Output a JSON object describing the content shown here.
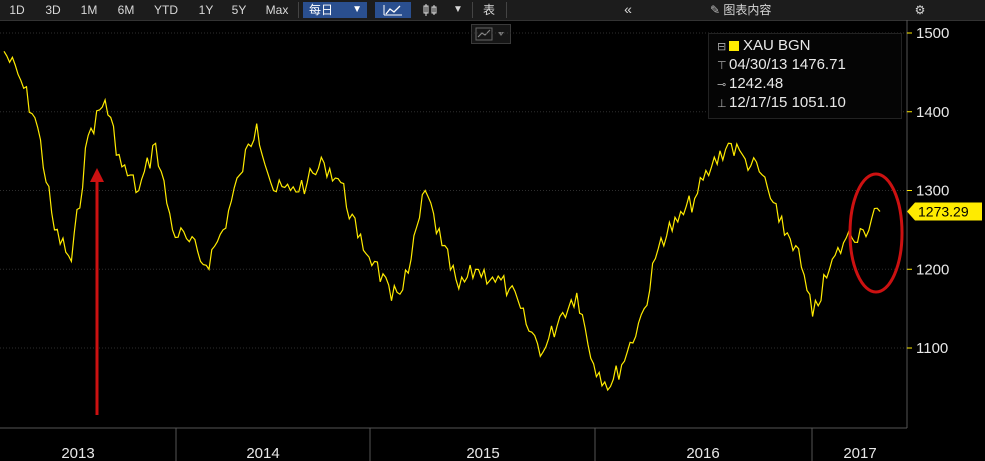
{
  "toolbar": {
    "ranges": [
      "1D",
      "3D",
      "1M",
      "6M",
      "YTD",
      "1Y",
      "5Y",
      "Max"
    ],
    "frequency": "每日",
    "table_label": "表",
    "collapse_label": "«",
    "chart_content_label": "图表内容",
    "colors": {
      "selected": "#2a4f8f",
      "bar": "#1c1c1c"
    }
  },
  "legend": {
    "security": "XAU BGN",
    "high_date": "04/30/13",
    "high_value": "1476.71",
    "average": "1242.48",
    "low_date": "12/17/15",
    "low_value": "1051.10"
  },
  "chart_data": {
    "type": "line",
    "series": [
      {
        "name": "XAU BGN",
        "color": "#ffeb00",
        "x": [
          "2012-12",
          "2013-01",
          "2013-02",
          "2013-03",
          "2013-04",
          "2013-05",
          "2013-06",
          "2013-07",
          "2013-08",
          "2013-09",
          "2013-10",
          "2013-11",
          "2013-12",
          "2014-01",
          "2014-02",
          "2014-03",
          "2014-04",
          "2014-05",
          "2014-06",
          "2014-07",
          "2014-08",
          "2014-09",
          "2014-10",
          "2014-11",
          "2014-12",
          "2015-01",
          "2015-02",
          "2015-03",
          "2015-04",
          "2015-05",
          "2015-06",
          "2015-07",
          "2015-08",
          "2015-09",
          "2015-10",
          "2015-11",
          "2015-12",
          "2016-01",
          "2016-02",
          "2016-03",
          "2016-04",
          "2016-05",
          "2016-06",
          "2016-07",
          "2016-08",
          "2016-09",
          "2016-10",
          "2016-11",
          "2016-12",
          "2017-01",
          "2017-02",
          "2017-03",
          "2017-04"
        ],
        "values": [
          1476.71,
          1440,
          1380,
          1250,
          1210,
          1370,
          1415,
          1330,
          1300,
          1360,
          1250,
          1235,
          1205,
          1250,
          1320,
          1385,
          1300,
          1300,
          1310,
          1335,
          1310,
          1240,
          1210,
          1160,
          1195,
          1300,
          1230,
          1175,
          1200,
          1190,
          1175,
          1130,
          1095,
          1140,
          1170,
          1080,
          1051.1,
          1095,
          1150,
          1240,
          1260,
          1290,
          1330,
          1360,
          1340,
          1320,
          1260,
          1230,
          1140,
          1200,
          1240,
          1250,
          1273.29
        ]
      }
    ],
    "last_value": "1273.29",
    "y_ticks": [
      1100,
      1200,
      1300,
      1400,
      1500
    ],
    "x_ticks": [
      "2013",
      "2014",
      "2015",
      "2016",
      "2017"
    ],
    "ylim": [
      1030,
      1530
    ],
    "grid": true,
    "annotations": [
      {
        "type": "arrow",
        "color": "#cc1111"
      },
      {
        "type": "ellipse",
        "color": "#cc1111"
      }
    ]
  }
}
